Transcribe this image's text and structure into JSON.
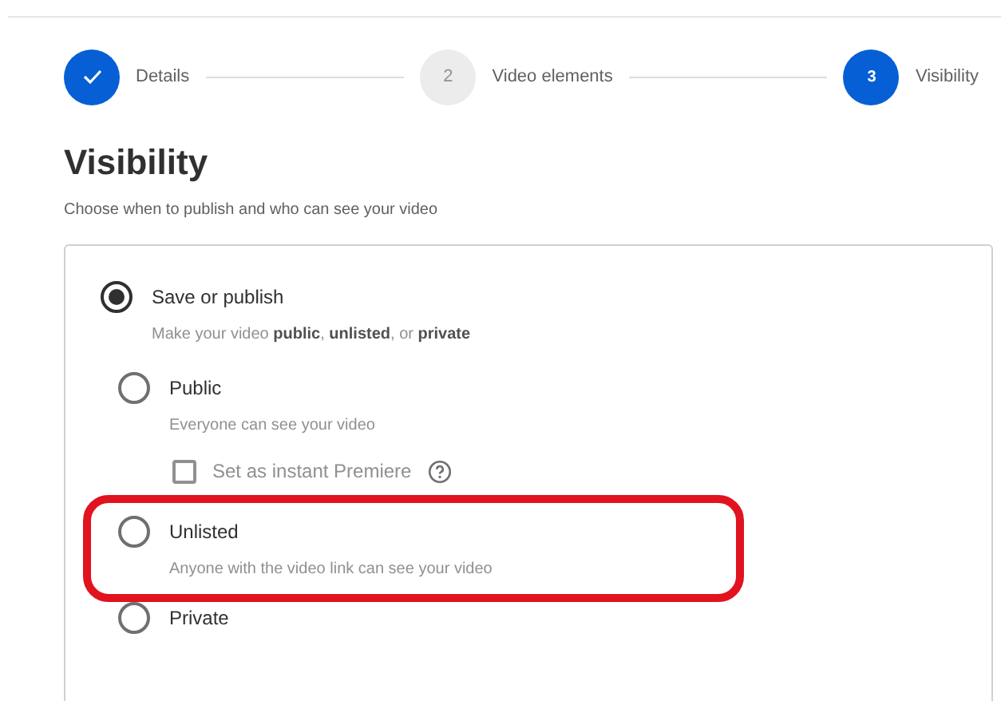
{
  "steps": [
    {
      "label": "Details",
      "kind": "done"
    },
    {
      "label": "Video elements",
      "number": "2",
      "kind": "pending"
    },
    {
      "label": "Visibility",
      "number": "3",
      "kind": "current"
    }
  ],
  "heading": "Visibility",
  "subtitle": "Choose when to publish and who can see your video",
  "save_or_publish": {
    "label": "Save or publish",
    "selected": true,
    "description": "Make your video **public**, **unlisted**, or **private**",
    "options": [
      {
        "label": "Public",
        "selected": false,
        "highlighted": false,
        "description": "Everyone can see your video",
        "checkbox": {
          "label": "Set as instant Premiere",
          "checked": false
        }
      },
      {
        "label": "Unlisted",
        "selected": false,
        "highlighted": true,
        "description": "Anyone with the video link can see your video"
      },
      {
        "label": "Private",
        "selected": false,
        "highlighted": false
      }
    ]
  }
}
